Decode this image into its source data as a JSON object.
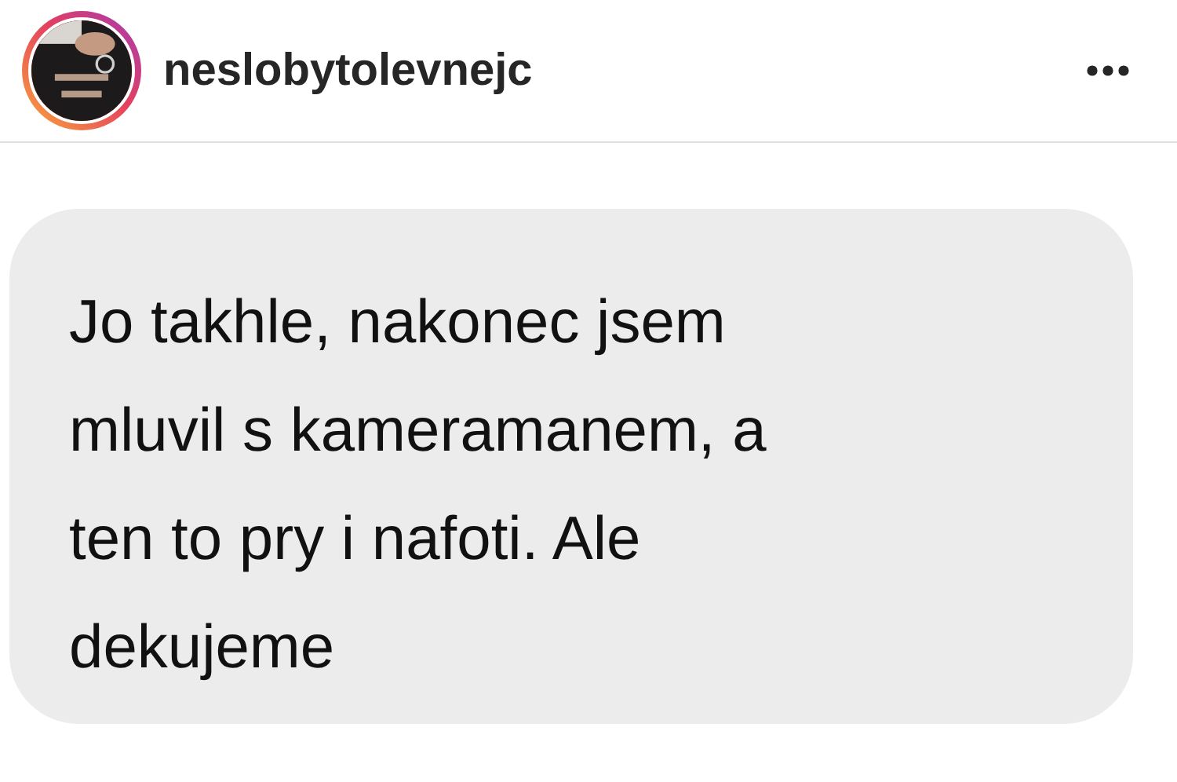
{
  "post_header": {
    "avatar": {
      "kind": "picture",
      "story_ring": true
    },
    "username": "neslobytolevnejc"
  },
  "message": {
    "lines": [
      "Jo takhle, nakonec jsem",
      "mluvil s kameramanem, a",
      "ten to pry i nafoti. Ale",
      "dekujeme"
    ]
  }
}
